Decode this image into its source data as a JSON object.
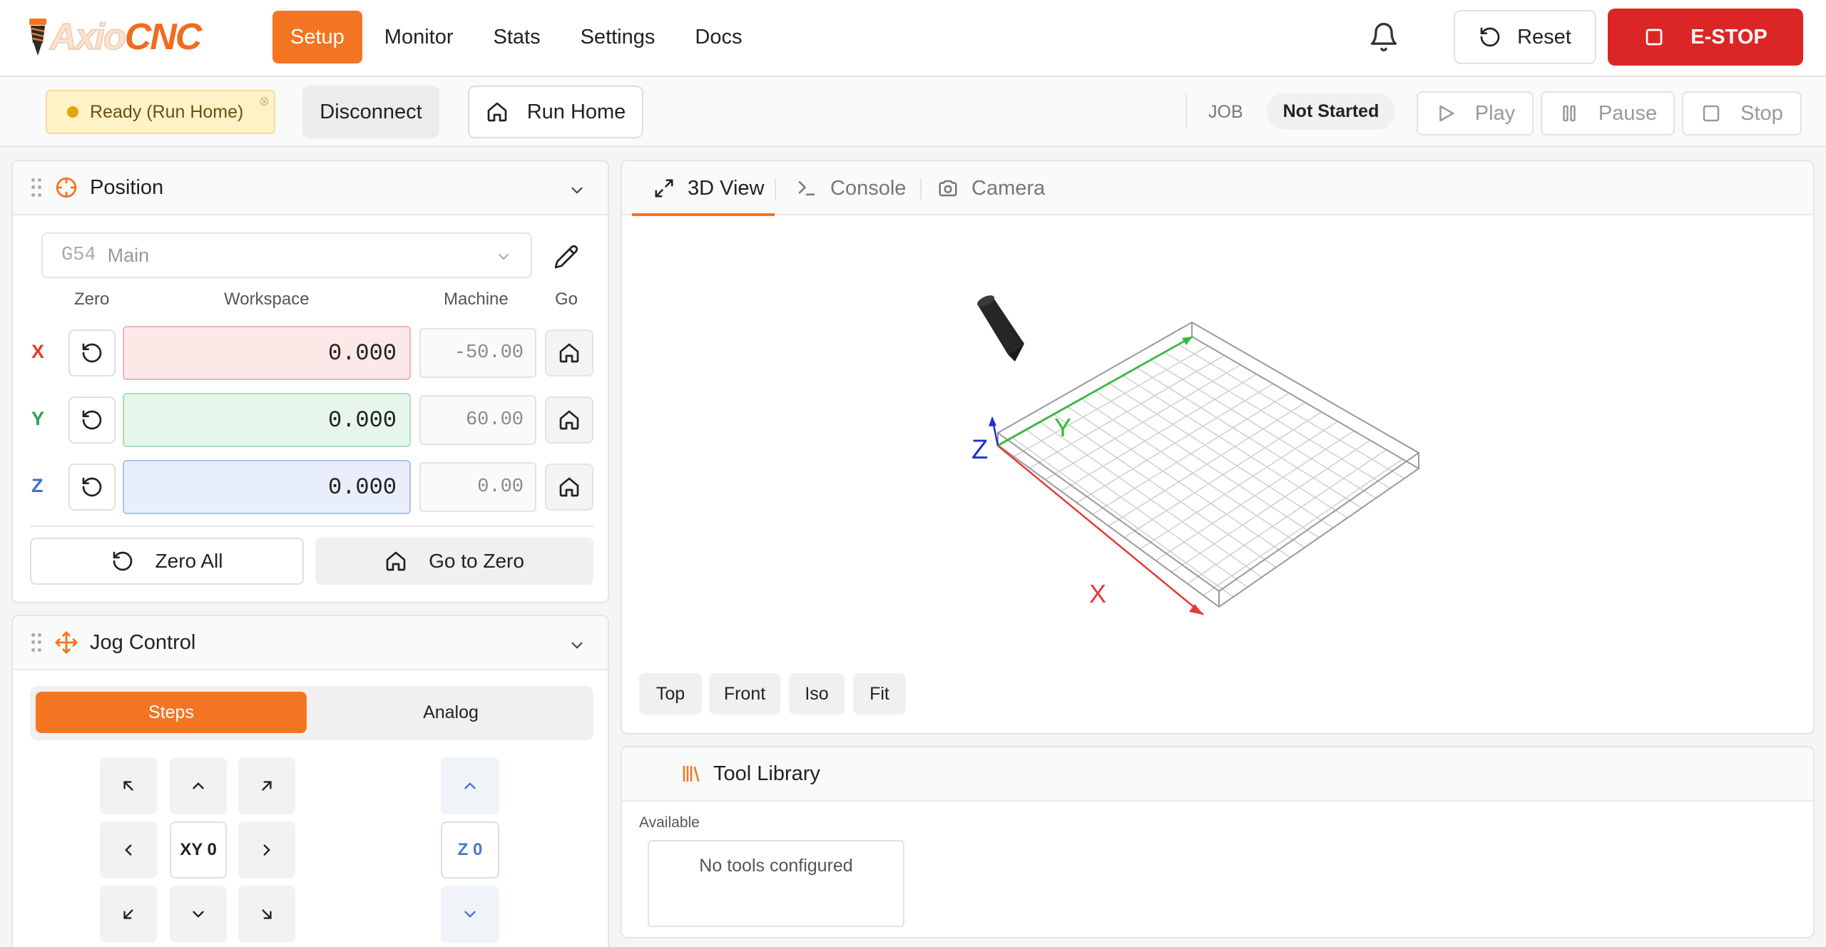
{
  "brand": {
    "part1": "Axio",
    "part2": "CNC",
    "accent": "#f47521"
  },
  "nav": {
    "items": [
      {
        "label": "Setup",
        "active": true
      },
      {
        "label": "Monitor"
      },
      {
        "label": "Stats"
      },
      {
        "label": "Settings"
      },
      {
        "label": "Docs"
      }
    ]
  },
  "header": {
    "reset_label": "Reset",
    "estop_label": "E-STOP",
    "estop_color": "#dc2626"
  },
  "connection": {
    "status": "Ready (Run Home)",
    "disconnect_label": "Disconnect",
    "run_home_label": "Run Home"
  },
  "job": {
    "label": "JOB",
    "status": "Not Started",
    "play_label": "Play",
    "pause_label": "Pause",
    "stop_label": "Stop"
  },
  "position": {
    "title": "Position",
    "wcs_code": "G54",
    "wcs_name": "Main",
    "columns": {
      "zero": "Zero",
      "workspace": "Workspace",
      "machine": "Machine",
      "go": "Go"
    },
    "axes": [
      {
        "label": "X",
        "workspace": "0.000",
        "machine": "-50.00",
        "color": "#e53935",
        "field_bg": "#fde8e8",
        "field_border": "#f3b3b3"
      },
      {
        "label": "Y",
        "workspace": "0.000",
        "machine": "60.00",
        "color": "#22a355",
        "field_bg": "#e6f6ea",
        "field_border": "#a9dfb8"
      },
      {
        "label": "Z",
        "workspace": "0.000",
        "machine": "0.00",
        "color": "#3b6fd1",
        "field_bg": "#e8effb",
        "field_border": "#aec3ea"
      }
    ],
    "zero_all_label": "Zero All",
    "go_to_zero_label": "Go to Zero"
  },
  "jog": {
    "title": "Jog Control",
    "modes": [
      "Steps",
      "Analog"
    ],
    "xy_zero_label": "XY 0",
    "z_zero_label": "Z 0"
  },
  "viewer": {
    "tabs": [
      {
        "label": "3D View",
        "icon": "expand-icon"
      },
      {
        "label": "Console",
        "icon": "terminal-icon"
      },
      {
        "label": "Camera",
        "icon": "camera-icon"
      }
    ],
    "axis_labels": {
      "x": "X",
      "y": "Y",
      "z": "Z"
    },
    "view_buttons": [
      "Top",
      "Front",
      "Iso",
      "Fit"
    ]
  },
  "tools": {
    "title": "Tool Library",
    "section": "Available",
    "empty": "No tools configured"
  }
}
